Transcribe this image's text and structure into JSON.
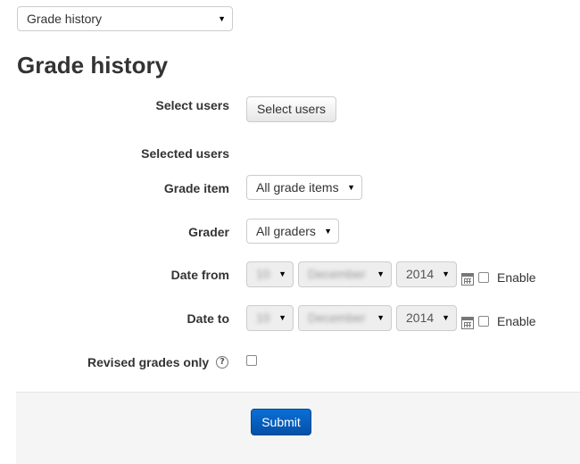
{
  "report_selector": {
    "value": "Grade history"
  },
  "page_title": "Grade history",
  "form": {
    "select_users": {
      "label": "Select users",
      "button": "Select users"
    },
    "selected_users": {
      "label": "Selected users"
    },
    "grade_item": {
      "label": "Grade item",
      "value": "All grade items"
    },
    "grader": {
      "label": "Grader",
      "value": "All graders"
    },
    "date_from": {
      "label": "Date from",
      "day": "10",
      "month": "December",
      "year": "2014",
      "enable_label": "Enable"
    },
    "date_to": {
      "label": "Date to",
      "day": "10",
      "month": "December",
      "year": "2014",
      "enable_label": "Enable"
    },
    "revised_only": {
      "label": "Revised grades only",
      "help": "?"
    },
    "submit": "Submit"
  },
  "icons": {
    "caret": "▾",
    "calendar": "calendar-icon",
    "help": "help-icon"
  },
  "colors": {
    "primary": "#0450a6",
    "footer_bg": "#f5f5f5"
  }
}
